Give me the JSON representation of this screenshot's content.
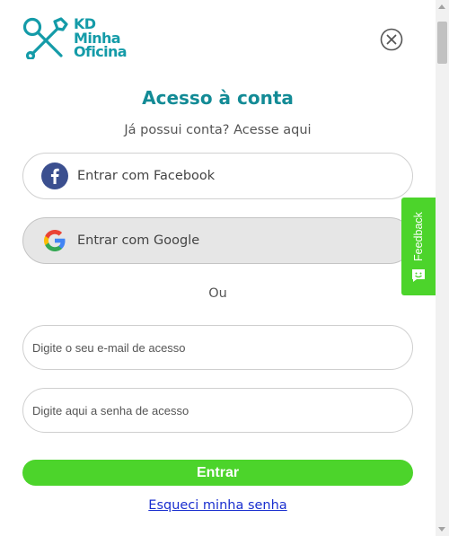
{
  "brand": {
    "lines": [
      "KD",
      "Minha",
      "Oficina"
    ],
    "color": "#149ba8",
    "logo_icon": "crossed-tools-icon"
  },
  "modal": {
    "close_icon": "close-circle-icon",
    "title": "Acesso à conta",
    "subtitle": "Já possui conta? Acesse aqui",
    "facebook_label": "Entrar com Facebook",
    "google_label": "Entrar com Google",
    "divider": "Ou",
    "email_placeholder": "Digite o seu e-mail de acesso",
    "password_placeholder": "Digite aqui a senha de acesso",
    "submit_label": "Entrar",
    "forgot_label": "Esqueci minha senha"
  },
  "feedback": {
    "label": "Feedback",
    "icon": "chat-smile-icon"
  },
  "colors": {
    "title": "#138b96",
    "accent_green": "#4cd42b",
    "facebook_blue": "#3b4f8f",
    "link_blue": "#1a2fcf"
  }
}
